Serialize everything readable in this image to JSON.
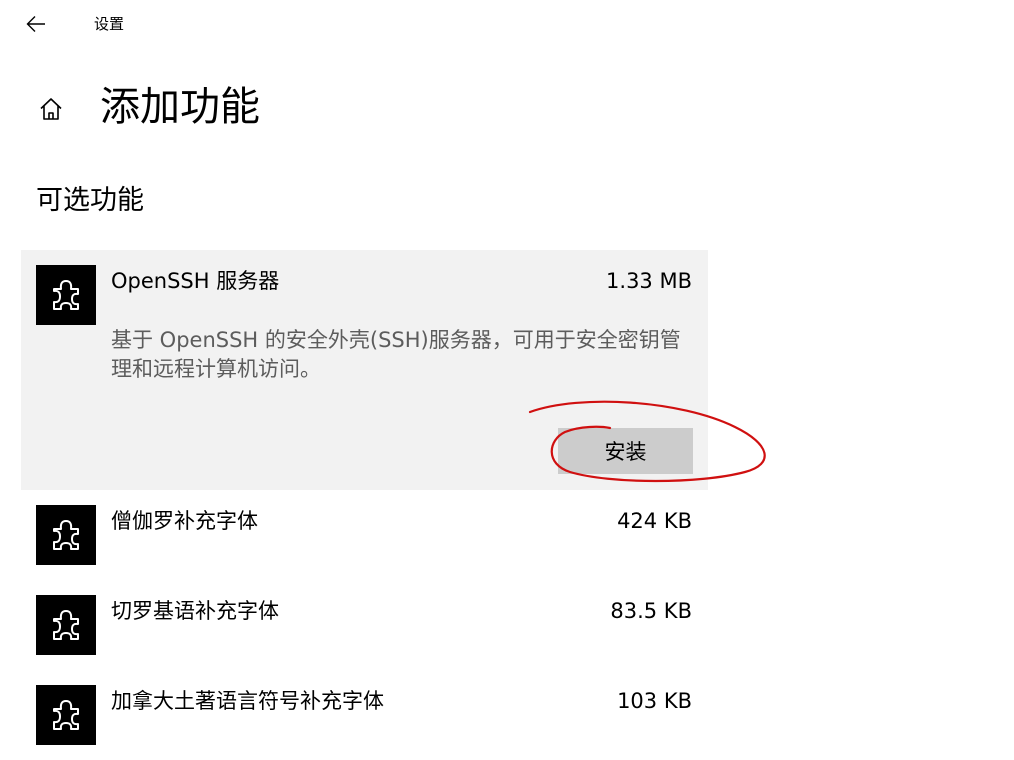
{
  "window": {
    "app_title": "设置"
  },
  "header": {
    "page_title": "添加功能"
  },
  "section": {
    "title": "可选功能"
  },
  "features": [
    {
      "name": "OpenSSH 服务器",
      "size": "1.33 MB",
      "description": "基于 OpenSSH 的安全外壳(SSH)服务器，可用于安全密钥管理和远程计算机访问。",
      "install_label": "安装",
      "expanded": true
    },
    {
      "name": "僧伽罗补充字体",
      "size": "424 KB"
    },
    {
      "name": "切罗基语补充字体",
      "size": "83.5 KB"
    },
    {
      "name": "加拿大土著语言符号补充字体",
      "size": "103 KB"
    }
  ],
  "icons": {
    "back": "back-arrow-icon",
    "home": "home-icon",
    "feature": "puzzle-piece-icon"
  },
  "colors": {
    "expanded_card_bg": "#f2f2f2",
    "install_button_bg": "#cccccc",
    "annotation_red": "#d01010",
    "description_text": "#5c5c5c"
  }
}
